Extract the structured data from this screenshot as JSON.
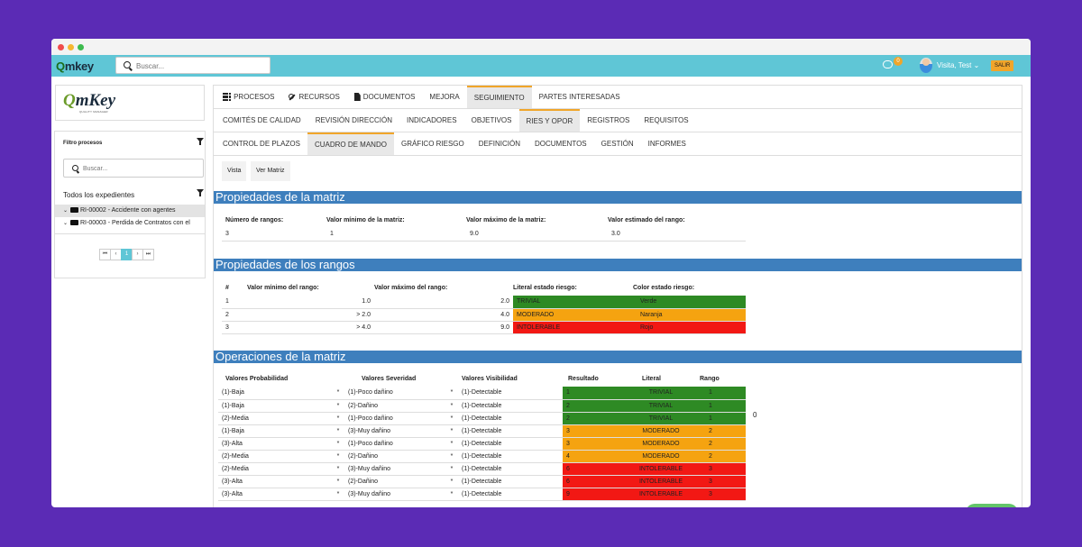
{
  "app": {
    "logo": "Qmkey",
    "logo_tagline": "QUALITY MANAGER"
  },
  "topbar": {
    "search_placeholder": "Buscar...",
    "notifications_count": "0",
    "user_name": "Visita, Test",
    "logout_label": "SALIR"
  },
  "sidebar": {
    "filter_title": "Filtro procesos",
    "search_placeholder": "Buscar...",
    "tree_title": "Todos los expedientes",
    "tree_items": [
      {
        "label": "RI-00002 - Accidente con agentes",
        "selected": true
      },
      {
        "label": "RI-00003 - Perdida de Contratos con el",
        "selected": false
      }
    ],
    "pagination": {
      "current": "1"
    }
  },
  "tabs": {
    "level1": [
      {
        "label": "PROCESOS",
        "icon": "grid-icon"
      },
      {
        "label": "RECURSOS",
        "icon": "wrench-icon"
      },
      {
        "label": "DOCUMENTOS",
        "icon": "document-icon"
      },
      {
        "label": "MEJORA"
      },
      {
        "label": "SEGUIMIENTO",
        "active": true
      },
      {
        "label": "PARTES INTERESADAS"
      }
    ],
    "level2": [
      {
        "label": "COMITÉS DE CALIDAD"
      },
      {
        "label": "REVISIÓN DIRECCIÓN"
      },
      {
        "label": "INDICADORES"
      },
      {
        "label": "OBJETIVOS"
      },
      {
        "label": "RIES Y OPOR",
        "active": true
      },
      {
        "label": "REGISTROS"
      },
      {
        "label": "REQUISITOS"
      }
    ],
    "level3": [
      {
        "label": "CONTROL DE PLAZOS"
      },
      {
        "label": "CUADRO DE MANDO",
        "active": true
      },
      {
        "label": "GRÁFICO RIESGO"
      },
      {
        "label": "DEFINICIÓN"
      },
      {
        "label": "DOCUMENTOS"
      },
      {
        "label": "GESTIÓN"
      },
      {
        "label": "INFORMES"
      }
    ]
  },
  "subbuttons": {
    "vista": "Vista",
    "ver_matriz": "Ver Matriz"
  },
  "matrix": {
    "title": "Propiedades de la matriz",
    "headers": [
      "Número de rangos:",
      "Valor mínimo de la matriz:",
      "Valor máximo de la matriz:",
      "Valor estimado del rango:"
    ],
    "values": [
      "3",
      "1",
      "9.0",
      "3.0"
    ]
  },
  "ranges": {
    "title": "Propiedades de los rangos",
    "headers": [
      "#",
      "Valor mínimo del rango:",
      "Valor máximo del rango:",
      "Literal estado riesgo:",
      "Color estado riesgo:"
    ],
    "rows": [
      {
        "n": "1",
        "min": "1.0",
        "max": "2.0",
        "literal": "TRIVIAL",
        "color": "Verde"
      },
      {
        "n": "2",
        "min": "> 2.0",
        "max": "4.0",
        "literal": "MODERADO",
        "color": "Naranja"
      },
      {
        "n": "3",
        "min": "> 4.0",
        "max": "9.0",
        "literal": "INTOLERABLE",
        "color": "Rojo"
      }
    ]
  },
  "operations": {
    "title": "Operaciones de la matriz",
    "headers": [
      "Valores Probabilidad",
      "Valores Severidad",
      "Valores Visibilidad",
      "Resultado",
      "Literal",
      "Rango"
    ],
    "note": "0",
    "operator": "*",
    "rows": [
      {
        "prob": "(1)-Baja",
        "sev": "(1)-Poco dañino",
        "vis": "(1)-Detectable",
        "res": "1",
        "lit": "TRIVIAL",
        "rango": "1"
      },
      {
        "prob": "(1)-Baja",
        "sev": "(2)-Dañino",
        "vis": "(1)-Detectable",
        "res": "2",
        "lit": "TRIVIAL",
        "rango": "1"
      },
      {
        "prob": "(2)-Media",
        "sev": "(1)-Poco dañino",
        "vis": "(1)-Detectable",
        "res": "2",
        "lit": "TRIVIAL",
        "rango": "1"
      },
      {
        "prob": "(1)-Baja",
        "sev": "(3)-Muy dañino",
        "vis": "(1)-Detectable",
        "res": "3",
        "lit": "MODERADO",
        "rango": "2"
      },
      {
        "prob": "(3)-Alta",
        "sev": "(1)-Poco dañino",
        "vis": "(1)-Detectable",
        "res": "3",
        "lit": "MODERADO",
        "rango": "2"
      },
      {
        "prob": "(2)-Media",
        "sev": "(2)-Dañino",
        "vis": "(1)-Detectable",
        "res": "4",
        "lit": "MODERADO",
        "rango": "2"
      },
      {
        "prob": "(2)-Media",
        "sev": "(3)-Muy dañino",
        "vis": "(1)-Detectable",
        "res": "6",
        "lit": "INTOLERABLE",
        "rango": "3"
      },
      {
        "prob": "(3)-Alta",
        "sev": "(2)-Dañino",
        "vis": "(1)-Detectable",
        "res": "6",
        "lit": "INTOLERABLE",
        "rango": "3"
      },
      {
        "prob": "(3)-Alta",
        "sev": "(3)-Muy dañino",
        "vis": "(1)-Detectable",
        "res": "9",
        "lit": "INTOLERABLE",
        "rango": "3"
      }
    ]
  }
}
